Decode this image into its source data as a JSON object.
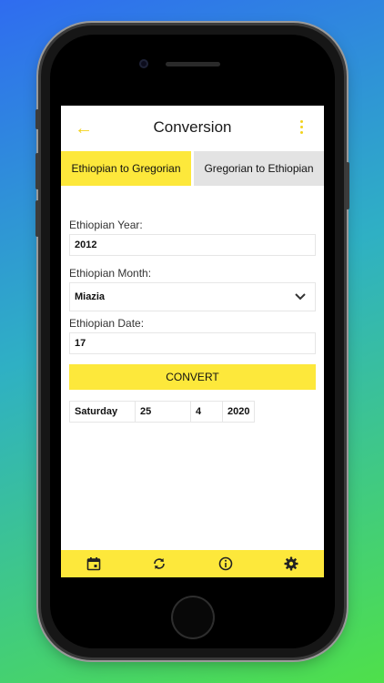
{
  "appbar": {
    "title": "Conversion",
    "back_icon": "arrow-left-icon",
    "menu_icon": "more-vertical-icon"
  },
  "tabs": [
    {
      "label": "Ethiopian to Gregorian",
      "active": true
    },
    {
      "label": "Gregorian to Ethiopian",
      "active": false
    }
  ],
  "form": {
    "year_label": "Ethiopian Year:",
    "year_value": "2012",
    "month_label": "Ethiopian Month:",
    "month_value": "Miazia",
    "date_label": "Ethiopian Date:",
    "date_value": "17",
    "convert_label": "CONVERT"
  },
  "result": {
    "weekday": "Saturday",
    "day": "25",
    "month": "4",
    "year": "2020"
  },
  "bottom_nav": [
    "calendar-icon",
    "sync-icon",
    "info-icon",
    "settings-icon"
  ],
  "colors": {
    "accent": "#fde83b",
    "icon_accent": "#f2d21c",
    "tab_inactive": "#e3e3e3"
  }
}
